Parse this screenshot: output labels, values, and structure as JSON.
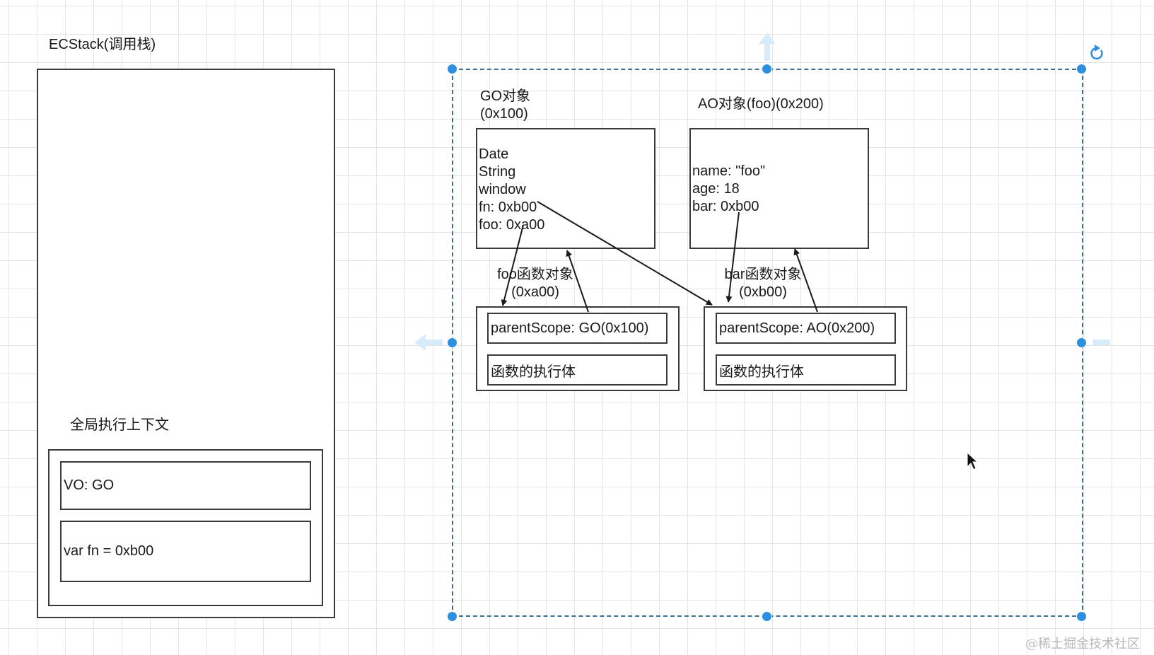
{
  "ecstack": {
    "title": "ECStack(调用栈)",
    "global_context": {
      "title": "全局执行上下文",
      "vo": "VO: GO",
      "code": "var fn = 0xb00"
    }
  },
  "go_object": {
    "title_line1": "GO对象",
    "title_line2": "(0x100)",
    "props": [
      "Date",
      "String",
      "window",
      "fn: 0xb00",
      "foo: 0xa00"
    ]
  },
  "ao_object": {
    "title": "AO对象(foo)(0x200)",
    "props": [
      "name: \"foo\"",
      "age: 18",
      "bar: 0xb00"
    ]
  },
  "foo_function": {
    "title_line1": "foo函数对象",
    "title_line2": "(0xa00)",
    "parent_scope": "parentScope: GO(0x100)",
    "body": "函数的执行体"
  },
  "bar_function": {
    "title_line1": "bar函数对象",
    "title_line2": "(0xb00)",
    "parent_scope": "parentScope: AO(0x200)",
    "body": "函数的执行体"
  },
  "colors": {
    "selection": "#2c8fe0",
    "stroke": "#1a1a1a",
    "grid": "#e4e4e4"
  },
  "icons": [
    "rotate-icon",
    "mouse-cursor-icon",
    "arrow-up-icon",
    "arrow-left-icon",
    "arrow-right-icon"
  ],
  "watermark": "@稀土掘金技术社区"
}
